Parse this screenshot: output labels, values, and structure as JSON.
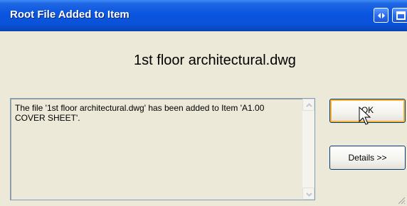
{
  "window": {
    "title": "Root File Added to Item",
    "title_buttons": [
      {
        "icon": "help-arrows-icon"
      },
      {
        "icon": "restore-icon"
      }
    ]
  },
  "dialog": {
    "file_heading": "1st floor architectural.dwg",
    "message": "The file '1st floor architectural.dwg' has been added to Item 'A1.00 COVER SHEET'.",
    "ok_label": "OK",
    "details_label": "Details >>"
  },
  "colors": {
    "titlebar": "#0a56e0",
    "dialog_bg": "#ece9d8",
    "focus_ring": "#f8b43a"
  }
}
